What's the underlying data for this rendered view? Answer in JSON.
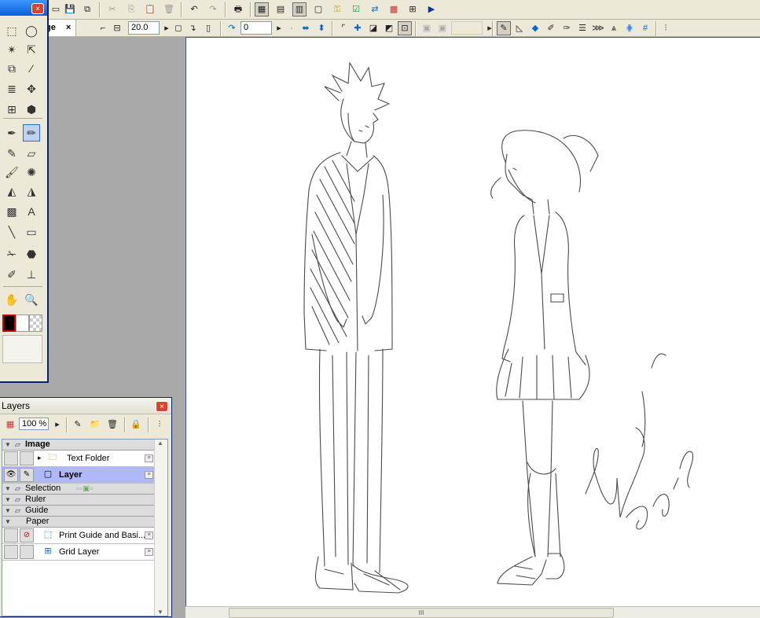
{
  "document": {
    "tab_label": "ge",
    "tab_close": "×"
  },
  "options_bar": {
    "brush_size": "20.0",
    "angle": "0"
  },
  "tools_panel": {
    "close_glyph": "×",
    "tools": [
      "rect-select-icon",
      "lasso-icon",
      "magic-wand-icon",
      "select-arrow-icon",
      "layer-select-icon",
      "eyedropper-icon",
      "gradient-lines-icon",
      "move-icon",
      "grid-tool-icon",
      "object-tool-icon",
      "pen-icon",
      "pencil-icon",
      "marker-icon",
      "eraser-icon",
      "brush-icon",
      "airbrush-icon",
      "fill-icon",
      "fill-plus-icon",
      "gradient-icon",
      "text-icon",
      "line-icon",
      "rectangle-icon",
      "correct-line-icon",
      "color-bucket-icon",
      "ruler-pen-icon",
      "stamp-icon",
      "hand-icon",
      "zoom-icon"
    ]
  },
  "layers_panel": {
    "title": "Layers",
    "opacity": "100 %",
    "rows": [
      {
        "type": "group",
        "label": "Image",
        "bold": true
      },
      {
        "type": "layer",
        "label": "Text Folder",
        "selected": false
      },
      {
        "type": "layer",
        "label": "Layer",
        "selected": true,
        "bold": true
      },
      {
        "type": "group",
        "label": "Selection"
      },
      {
        "type": "group",
        "label": "Ruler"
      },
      {
        "type": "group",
        "label": "Guide"
      },
      {
        "type": "group",
        "label": "Paper"
      },
      {
        "type": "layer",
        "label": "Print Guide and Basi...",
        "selected": false
      },
      {
        "type": "layer",
        "label": "Grid Layer",
        "selected": false
      }
    ]
  },
  "scrollbar": {
    "grip": "III"
  }
}
